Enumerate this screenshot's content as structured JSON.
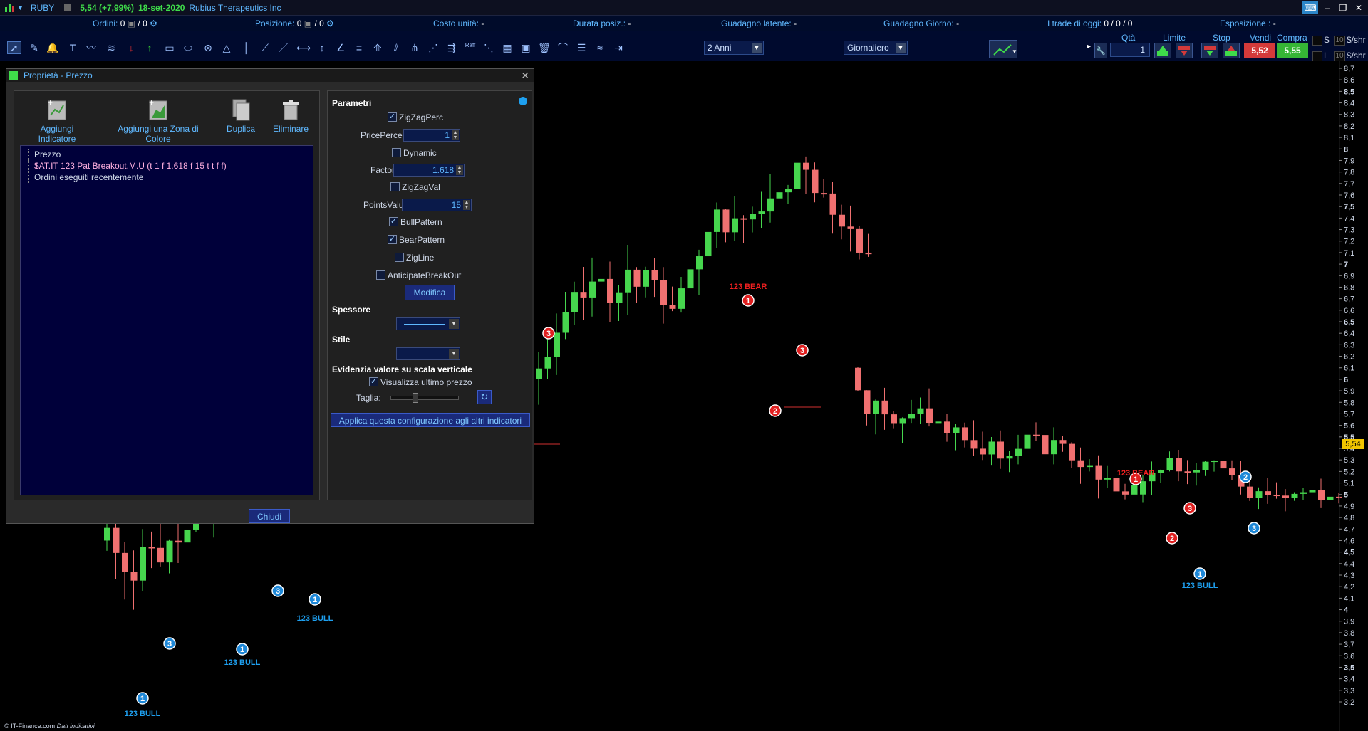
{
  "titlebar": {
    "symbol": "RUBY",
    "price_change": "5,54 (+7,99%)",
    "date": "18-set-2020",
    "company": "Rubius Therapeutics Inc"
  },
  "infostrip": {
    "ordini_label": "Ordini:",
    "ordini_value": "0",
    "ordini_value2": "/ 0",
    "posizione_label": "Posizione:",
    "posizione_value": "0",
    "posizione_value2": "/ 0",
    "costo_label": "Costo unità:",
    "costo_value": "-",
    "durata_label": "Durata posiz.:",
    "durata_value": "-",
    "guadagno_latente_label": "Guadagno latente:",
    "guadagno_latente_value": "-",
    "guadagno_giorno_label": "Guadagno Giorno:",
    "guadagno_giorno_value": "-",
    "trade_oggi_label": "I trade di oggi:",
    "trade_oggi_value": "0 / 0 / 0",
    "esposizione_label": "Esposizione :",
    "esposizione_value": "-"
  },
  "toolbar": {
    "period": "2 Anni",
    "interval": "Giornaliero",
    "qty_label": "Qtà",
    "qty_value": "1",
    "limite_label": "Limite",
    "stop_label": "Stop",
    "vendi_label": "Vendi",
    "compra_label": "Compra",
    "vendi_price": "5,52",
    "compra_price": "5,55",
    "s_label": "S",
    "l_label": "L",
    "s_qty": "10",
    "l_qty": "10",
    "unit_s": "$/shr",
    "unit_l": "$/shr",
    "raff_label": "Raff"
  },
  "dialog": {
    "title": "Proprietà - Prezzo",
    "actions": [
      "Aggiungi Indicatore",
      "Aggiungi una Zona di Colore",
      "Duplica",
      "Eliminare"
    ],
    "tree": [
      "Prezzo",
      "$AT.IT 123 Pat Breakout.M.U (t 1 f 1.618 f 15 t t f f)",
      "Ordini eseguiti recentemente"
    ],
    "params_title": "Parametri",
    "zigzagperc": "ZigZagPerc",
    "pricepercent_label": "PricePercent",
    "pricepercent_value": "1",
    "dynamic": "Dynamic",
    "factor_label": "Factor",
    "factor_value": "1.618",
    "zigzagval": "ZigZagVal",
    "pointsvalue_label": "PointsValue",
    "pointsvalue_value": "15",
    "bullpattern": "BullPattern",
    "bearpattern": "BearPattern",
    "zigline": "ZigLine",
    "anticipate": "AnticipateBreakOut",
    "modifica": "Modifica",
    "spessore": "Spessore",
    "stile": "Stile",
    "evidenzia": "Evidenzia valore su scala verticale",
    "visualizza": "Visualizza ultimo prezzo",
    "taglia": "Taglia:",
    "applica": "Applica questa configurazione agli altri indicatori",
    "chiudi": "Chiudi"
  },
  "chart_data": {
    "type": "candlestick",
    "y_axis_labels": [
      "8,7",
      "8,6",
      "8,5",
      "8,4",
      "8,3",
      "8,2",
      "8,1",
      "8",
      "7,9",
      "7,8",
      "7,7",
      "7,6",
      "7,5",
      "7,4",
      "7,3",
      "7,2",
      "7,1",
      "7",
      "6,9",
      "6,8",
      "6,7",
      "6,6",
      "6,5",
      "6,4",
      "6,3",
      "6,2",
      "6,1",
      "6",
      "5,9",
      "5,8",
      "5,7",
      "5,6",
      "5,5",
      "5,4",
      "5,3",
      "5,2",
      "5,1",
      "5",
      "4,9",
      "4,8",
      "4,7",
      "4,6",
      "4,5",
      "4,4",
      "4,3",
      "4,2",
      "4,1",
      "4",
      "3,9",
      "3,8",
      "3,7",
      "3,6",
      "3,5",
      "3,4",
      "3,3",
      "3,2"
    ],
    "y_bold": [
      "8,5",
      "8",
      "7,5",
      "7",
      "6,5",
      "6",
      "5,5",
      "5",
      "4,5",
      "4",
      "3,5"
    ],
    "ylim": [
      3.2,
      8.7
    ],
    "last_price": "5,54",
    "pattern_labels": [
      {
        "text": "123 BULL",
        "color": "#1ea0f0"
      },
      {
        "text": "123 BULL",
        "color": "#1ea0f0"
      },
      {
        "text": "123 BULL",
        "color": "#1ea0f0"
      },
      {
        "text": "123 BEAR",
        "color": "#f02020"
      },
      {
        "text": "123 BEAR",
        "color": "#f02020"
      },
      {
        "text": "123 BULL",
        "color": "#1ea0f0"
      }
    ]
  },
  "footer": {
    "brand": "© IT-Finance.com",
    "note": "Dati indicativi"
  }
}
